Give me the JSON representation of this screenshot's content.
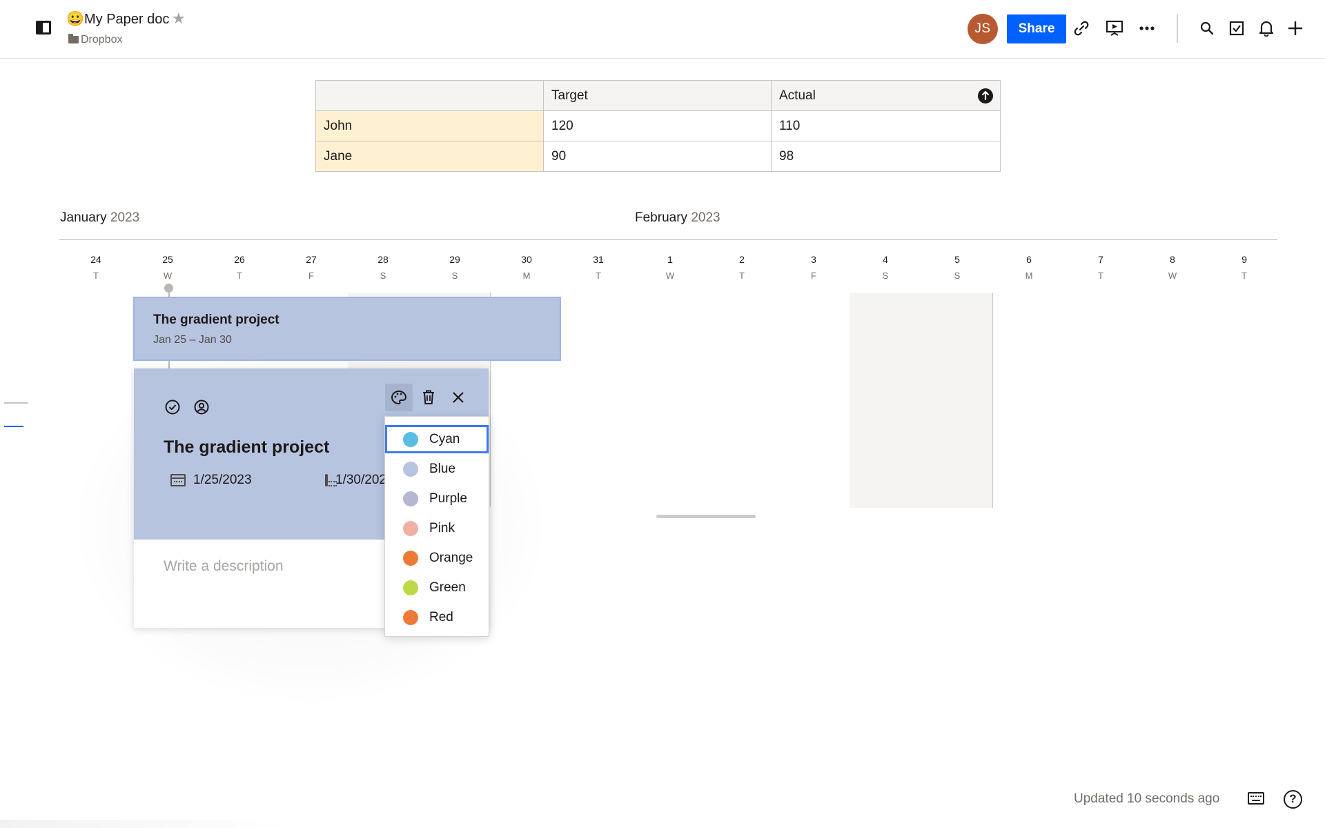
{
  "header": {
    "doc_emoji": "😀",
    "doc_title": "My Paper doc",
    "breadcrumb": "Dropbox",
    "avatar_initials": "JS",
    "share_label": "Share",
    "icons": [
      "sidebar-toggle-icon",
      "star-icon",
      "folder-icon",
      "link-icon",
      "present-icon",
      "more-icon",
      "search-icon",
      "checklist-icon",
      "bell-icon",
      "plus-icon"
    ]
  },
  "table": {
    "headers": [
      "",
      "Target",
      "Actual"
    ],
    "rows": [
      {
        "name": "John",
        "target": "120",
        "actual": "110"
      },
      {
        "name": "Jane",
        "target": "90",
        "actual": "98"
      }
    ]
  },
  "timeline": {
    "months": [
      {
        "name": "January",
        "year": "2023"
      },
      {
        "name": "February",
        "year": "2023"
      }
    ],
    "days": [
      {
        "num": "24",
        "wd": "T"
      },
      {
        "num": "25",
        "wd": "W"
      },
      {
        "num": "26",
        "wd": "T"
      },
      {
        "num": "27",
        "wd": "F"
      },
      {
        "num": "28",
        "wd": "S"
      },
      {
        "num": "29",
        "wd": "S"
      },
      {
        "num": "30",
        "wd": "M"
      },
      {
        "num": "31",
        "wd": "T"
      },
      {
        "num": "1",
        "wd": "W"
      },
      {
        "num": "2",
        "wd": "T"
      },
      {
        "num": "3",
        "wd": "F"
      },
      {
        "num": "4",
        "wd": "S"
      },
      {
        "num": "5",
        "wd": "S"
      },
      {
        "num": "6",
        "wd": "M"
      },
      {
        "num": "7",
        "wd": "T"
      },
      {
        "num": "8",
        "wd": "W"
      },
      {
        "num": "9",
        "wd": "T"
      }
    ],
    "bar": {
      "title": "The gradient project",
      "dates": "Jan 25 – Jan 30"
    }
  },
  "card": {
    "title": "The gradient project",
    "start_date": "1/25/2023",
    "end_date": "1/30/2023",
    "description_placeholder": "Write a description",
    "toolbar_icons": [
      "palette-icon",
      "trash-icon",
      "close-icon"
    ]
  },
  "color_menu": {
    "selected": "Cyan",
    "options": [
      {
        "label": "Cyan",
        "color": "#5bbde4"
      },
      {
        "label": "Blue",
        "color": "#b6c4e0"
      },
      {
        "label": "Purple",
        "color": "#b4b7d2"
      },
      {
        "label": "Pink",
        "color": "#f0b0a4"
      },
      {
        "label": "Orange",
        "color": "#ee7a38"
      },
      {
        "label": "Green",
        "color": "#bcd94a"
      },
      {
        "label": "Red",
        "color": "#ee7a38"
      }
    ]
  },
  "footer": {
    "status": "Updated 10 seconds ago",
    "help_glyph": "?"
  },
  "colors": {
    "accent": "#0061fe",
    "bar_fill": "#b6c4e0",
    "name_cell": "#fdf1d1",
    "avatar": "#b85a31"
  }
}
